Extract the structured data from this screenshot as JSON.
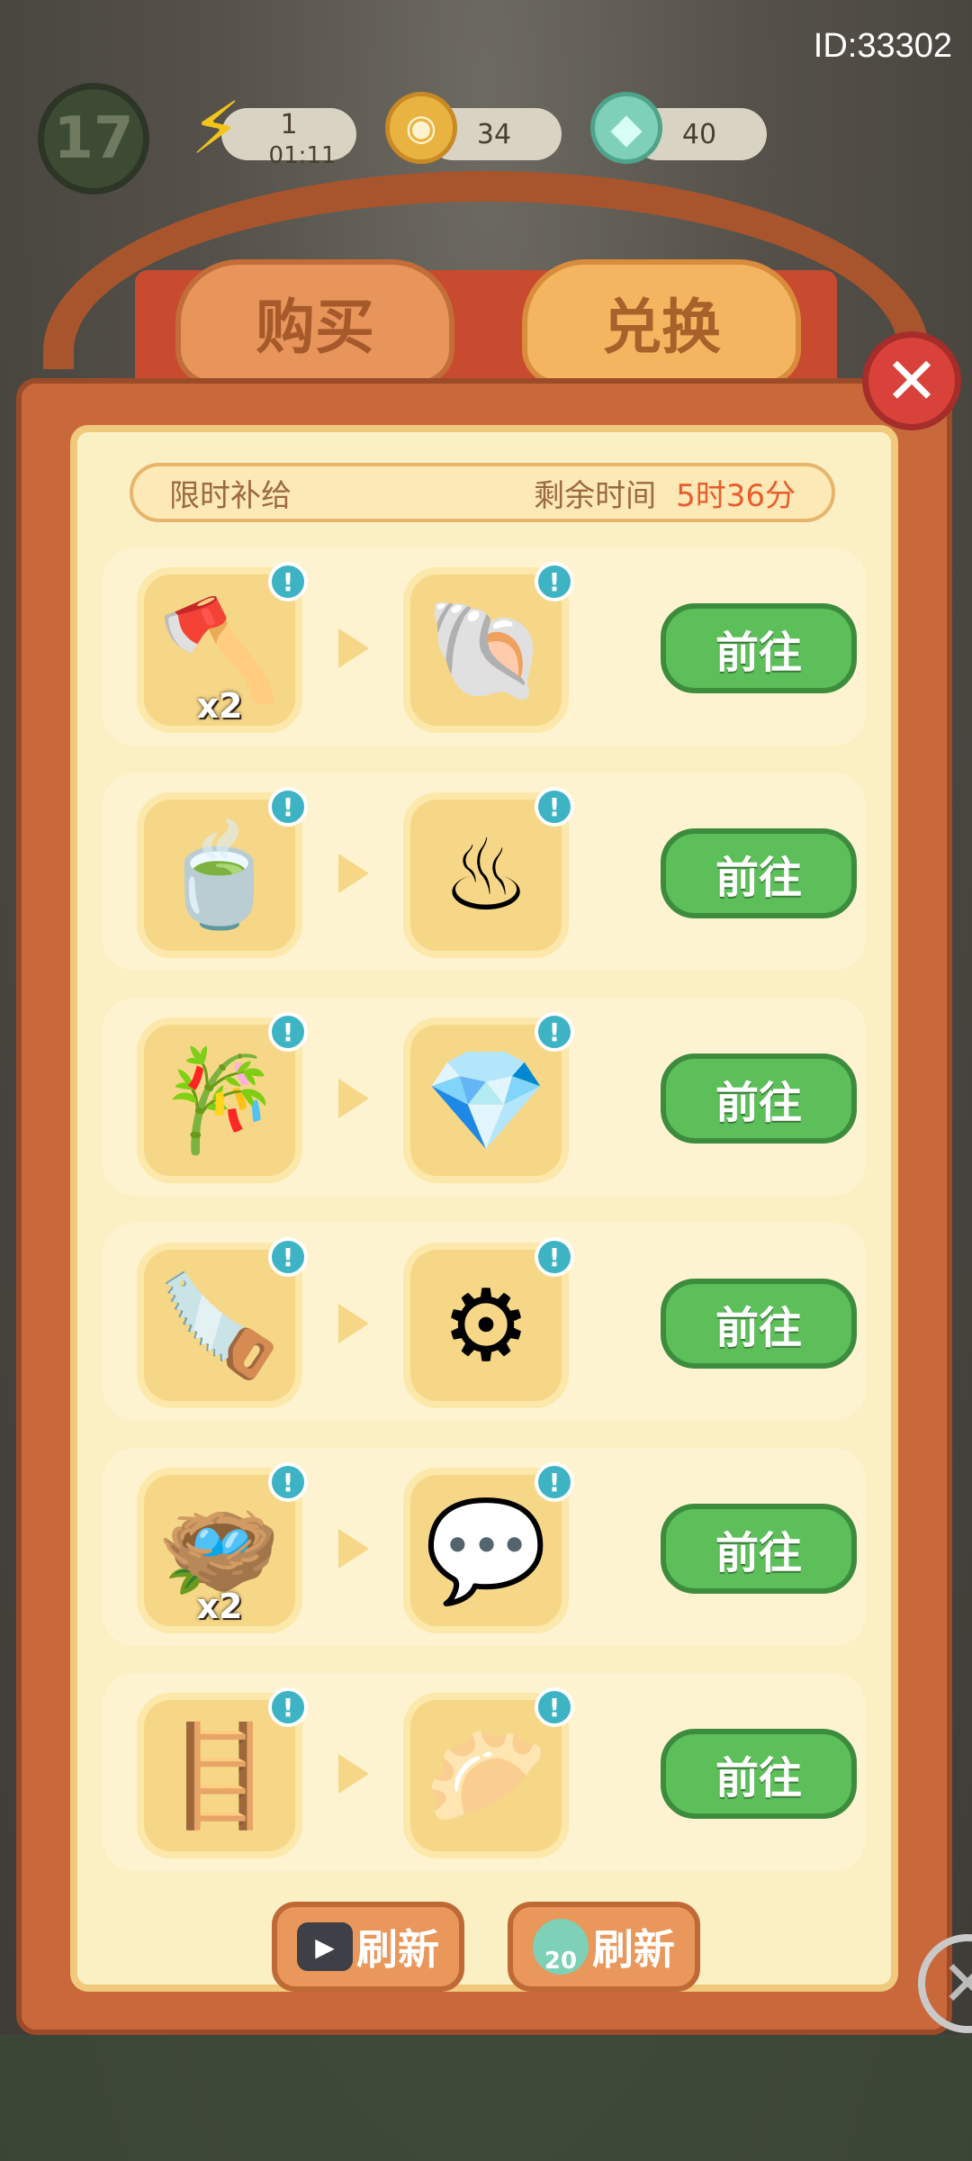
{
  "hud": {
    "id_label": "ID:33302",
    "level": "17",
    "energy": "1",
    "energy_timer": "01:11",
    "coins": "34",
    "gems": "40",
    "icons": [
      "lightning-icon",
      "coin-icon",
      "gem-drop-icon"
    ]
  },
  "tabs": [
    {
      "label": "购买"
    },
    {
      "label": "兑换"
    }
  ],
  "banner": {
    "title": "限时补给",
    "remaining_label": "剩余时间",
    "remaining_value": "5时36分"
  },
  "rows": [
    {
      "input_icon": "axe-icon",
      "input_glyph": "🪓",
      "input_qty": "x2",
      "output_icon": "shell-crate-icon",
      "output_glyph": "🐚",
      "button": "前往"
    },
    {
      "input_icon": "matcha-bowl-icon",
      "input_glyph": "🍵",
      "input_qty": "",
      "output_icon": "steamer-crate-icon",
      "output_glyph": "♨",
      "button": "前往"
    },
    {
      "input_icon": "bamboo-icon",
      "input_glyph": "🎋",
      "input_qty": "",
      "output_icon": "gem-chest-icon",
      "output_glyph": "💎",
      "button": "前往"
    },
    {
      "input_icon": "saw-icon",
      "input_glyph": "🪚",
      "input_qty": "",
      "output_icon": "gears-crate-icon",
      "output_glyph": "⚙",
      "button": "前往"
    },
    {
      "input_icon": "nest-icon",
      "input_glyph": "🪺",
      "input_qty": "x2",
      "output_icon": "speech-crate-icon",
      "output_glyph": "💬",
      "button": "前往"
    },
    {
      "input_icon": "bamboo-frame-icon",
      "input_glyph": "🪜",
      "input_qty": "",
      "output_icon": "dumpling-crate-icon",
      "output_glyph": "🥟",
      "button": "前往"
    }
  ],
  "alert_mark": "!",
  "refresh": {
    "ad_label": "刷新",
    "gem_label": "刷新",
    "gem_cost": "20"
  },
  "colors": {
    "go_button": "#5cbf5a",
    "alert": "#3eb3c4",
    "remaining_value": "#e85c2c"
  }
}
